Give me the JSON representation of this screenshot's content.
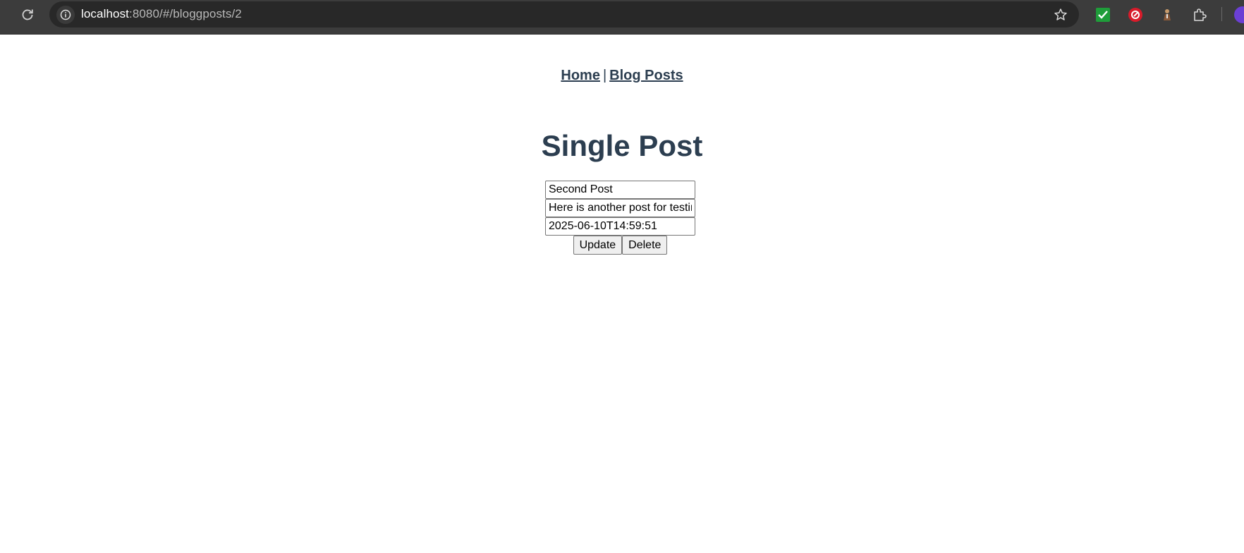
{
  "browser": {
    "url_host": "localhost",
    "url_rest": ":8080/#/bloggposts/2"
  },
  "nav": {
    "home": "Home",
    "separator": "|",
    "blog_posts": "Blog Posts"
  },
  "page": {
    "title": "Single Post"
  },
  "form": {
    "title_value": "Second Post",
    "content_value": "Here is another post for testing",
    "date_value": "2025-06-10T14:59:51",
    "update_label": "Update",
    "delete_label": "Delete"
  },
  "colors": {
    "heading": "#2c3e50",
    "chrome_bg": "#3c3c3c",
    "omnibox_bg": "#282828"
  }
}
